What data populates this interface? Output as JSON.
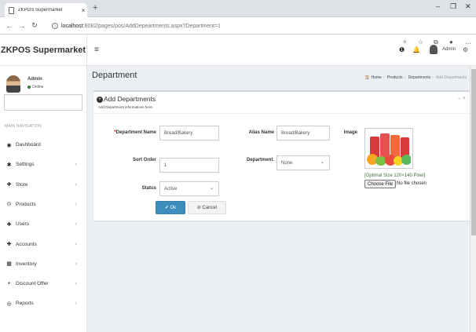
{
  "browser": {
    "tab_title": "ZKPOS Supermarket",
    "tab_close": "×",
    "new_tab": "+",
    "url_host": "localhost",
    "url_path": ":8082/pages/pos/AddDepeartments.aspx?Department=1",
    "win_min": "–",
    "win_max": "❐",
    "win_close": "✕"
  },
  "app": {
    "logo": "ZKPOS Supermarket",
    "header_user": "Admin",
    "notif_icon": "bell-icon",
    "alert_icon": "info-icon"
  },
  "sidebar": {
    "user_name": "Admin",
    "user_status": "Online",
    "nav_header": "MAIN NAVIGATION",
    "items": [
      {
        "label": "Dashboard",
        "icon": "dashboard-icon",
        "glyph": "◉",
        "has_children": false
      },
      {
        "label": "Settings",
        "icon": "gear-icon",
        "glyph": "✱",
        "has_children": true
      },
      {
        "label": "Store",
        "icon": "users-icon",
        "glyph": "✚",
        "has_children": true
      },
      {
        "label": "Products",
        "icon": "product-icon",
        "glyph": "⊙",
        "has_children": true
      },
      {
        "label": "Users",
        "icon": "users-icon",
        "glyph": "✚",
        "has_children": true
      },
      {
        "label": "Accounts",
        "icon": "users-icon",
        "glyph": "✚",
        "has_children": true
      },
      {
        "label": "Inventory",
        "icon": "inventory-icon",
        "glyph": "▦",
        "has_children": true
      },
      {
        "label": "Discount Offer",
        "icon": "plus-icon",
        "glyph": "+",
        "has_children": true
      },
      {
        "label": "Reports",
        "icon": "reports-icon",
        "glyph": "◎",
        "has_children": true
      }
    ]
  },
  "page": {
    "title": "Department",
    "breadcrumb": {
      "home": "Home",
      "products": "Products",
      "departments": "Departments",
      "current": "Add Departments"
    }
  },
  "form": {
    "box_title": "Add Departments",
    "box_subtitle": "Add Department informations here.",
    "box_tools": "– ×",
    "department_name_label": "Department Name",
    "department_name_value": "Bread/Bakery",
    "alias_name_label": "Alias Name",
    "alias_name_value": "Bread/Bakery",
    "image_label": "Image",
    "sort_order_label": "Sort Order",
    "sort_order_value": "1",
    "department_label": "Department.",
    "department_value": "None",
    "status_label": "Status",
    "status_value": "Active",
    "image_size_hint": "[Optimal Size 120×140 Pixel]",
    "choose_file_label": "Choose File",
    "no_file_text": "No file chosen",
    "ok_label": "✔ Ok",
    "cancel_label": "⊘ Cancel"
  },
  "colors": {
    "primary": "#3c8dbc",
    "content_bg": "#ecf0f5",
    "online": "#3c763d",
    "required": "#cc0000"
  }
}
